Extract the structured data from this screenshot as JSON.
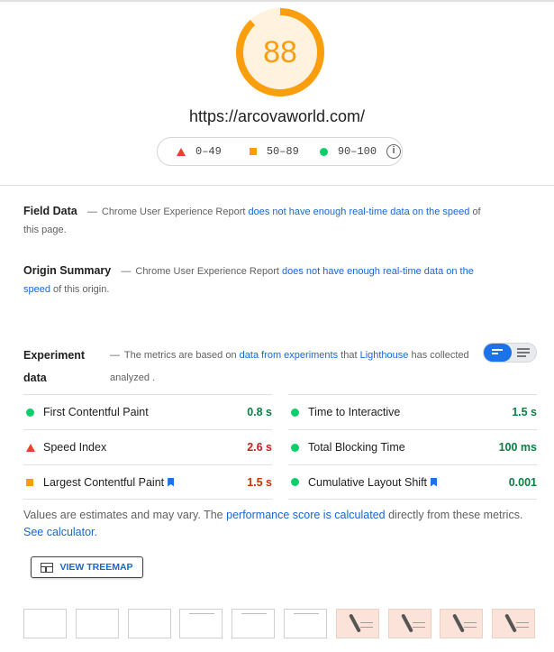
{
  "report": {
    "score": "88",
    "score_fraction": 0.88,
    "url": "https://arcovaworld.com/",
    "colors": {
      "average": "#fa9e0d",
      "fail": "#eb3f2f",
      "pass": "#0cce6b",
      "link": "#1967d2"
    }
  },
  "legend": {
    "fail_range": "0–49",
    "average_range": "50–89",
    "pass_range": "90–100",
    "info_icon": "i"
  },
  "field_data": {
    "title": "Field Data",
    "dash": "—",
    "prefix": "Chrome User Experience Report",
    "link": "does not have enough real-time data on the speed",
    "suffix": "of this page."
  },
  "origin_summary": {
    "title": "Origin Summary",
    "dash": "—",
    "prefix": "Chrome User Experience Report",
    "link": "does not have enough real-time data on the speed",
    "suffix": "of this origin."
  },
  "experiment": {
    "title": "Experiment data",
    "dash": "—",
    "prefix": "The metrics are based on",
    "link1": "data from experiments",
    "mid": "that",
    "link2": "Lighthouse",
    "suffix": "has collected analyzed ."
  },
  "metrics": {
    "left": [
      {
        "name": "First Contentful Paint",
        "value": "0.8 s",
        "status": "pass"
      },
      {
        "name": "Speed Index",
        "value": "2.6 s",
        "status": "fail"
      },
      {
        "name": "Largest Contentful Paint",
        "value": "1.5 s",
        "status": "average"
      }
    ],
    "right": [
      {
        "name": "Time to Interactive",
        "value": "1.5 s",
        "status": "pass"
      },
      {
        "name": "Total Blocking Time",
        "value": "100 ms",
        "status": "pass"
      },
      {
        "name": "Cumulative Layout Shift",
        "value": "0.001",
        "status": "pass"
      }
    ]
  },
  "note": {
    "prefix": "Values are estimates and may vary. The",
    "link1": "performance score is calculated",
    "mid": "directly from these metrics.",
    "link2": "See calculator."
  },
  "treemap": {
    "label": "VIEW TREEMAP",
    "icon": "treemap-icon"
  },
  "filmstrip": {
    "frames": 10
  }
}
